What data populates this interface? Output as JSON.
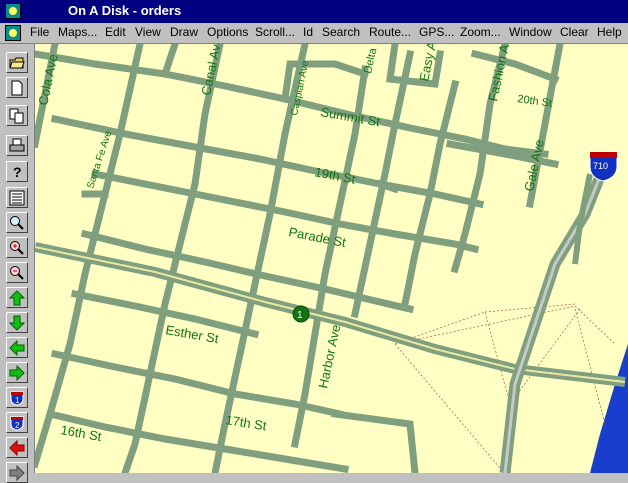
{
  "window": {
    "title": "On A Disk - orders"
  },
  "menu": [
    {
      "label": "File"
    },
    {
      "label": "Maps..."
    },
    {
      "label": "Edit"
    },
    {
      "label": "View"
    },
    {
      "label": "Draw"
    },
    {
      "label": "Options"
    },
    {
      "label": "Scroll..."
    },
    {
      "label": "Id"
    },
    {
      "label": "Search"
    },
    {
      "label": "Route..."
    },
    {
      "label": "GPS..."
    },
    {
      "label": "Zoom..."
    },
    {
      "label": "Window"
    },
    {
      "label": "Clear"
    },
    {
      "label": "Help"
    }
  ],
  "toolbar": [
    {
      "icon": "open-folder-icon"
    },
    {
      "icon": "new-page-icon"
    },
    {
      "icon": "copy-icon"
    },
    {
      "icon": "print-icon"
    },
    {
      "icon": "help-icon"
    },
    {
      "icon": "list-icon"
    },
    {
      "icon": "magnifier-icon"
    },
    {
      "icon": "zoom-in-icon"
    },
    {
      "icon": "zoom-out-icon"
    },
    {
      "icon": "arrow-up-icon"
    },
    {
      "icon": "arrow-down-icon"
    },
    {
      "icon": "arrow-left-icon"
    },
    {
      "icon": "arrow-right-icon"
    },
    {
      "icon": "interstate-1-icon"
    },
    {
      "icon": "interstate-2-icon"
    },
    {
      "icon": "red-arrow-left-icon"
    }
  ],
  "map": {
    "colors": {
      "land": "#ffffc4",
      "road": "#7f9f7f",
      "label": "#137313",
      "water": "#1a3ecc"
    },
    "streets": {
      "cola": "Cola Ave",
      "canal": "Canal Ave",
      "caspian": "Caspian Ave",
      "delta": "Delta",
      "easy": "Easy A",
      "fashion": "Fashion A",
      "twentieth": "20th St",
      "summit": "Summit St",
      "santafe": "Santa Fe Ave",
      "nineteenth": "19th St",
      "gale": "Gale Ave",
      "parade": "Parade St",
      "esther": "Esther St",
      "harbor": "Harbor Ave",
      "seventeenth": "17th St",
      "sixteenth": "16th St"
    },
    "shields": {
      "interstate": "710",
      "route": "1"
    }
  }
}
